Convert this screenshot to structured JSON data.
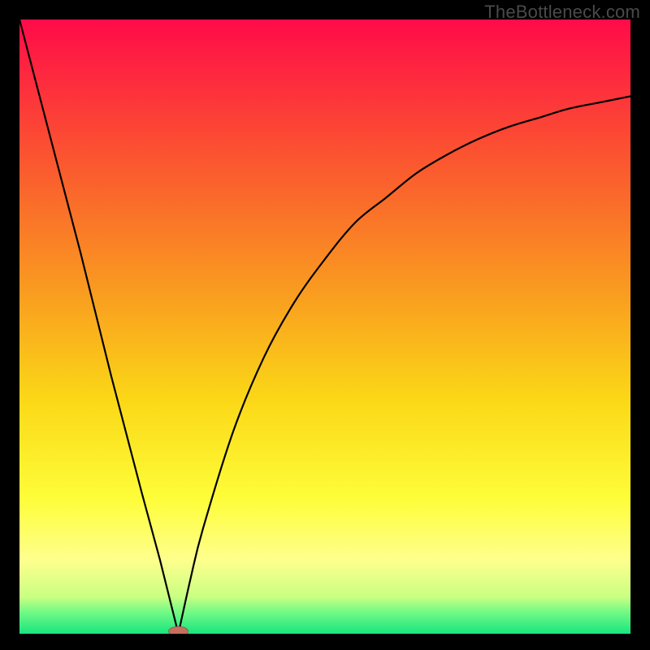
{
  "watermark": "TheBottleneck.com",
  "chart_data": {
    "type": "line",
    "title": "",
    "xlabel": "",
    "ylabel": "",
    "x_range": [
      0,
      100
    ],
    "y_range": [
      0,
      100
    ],
    "series": [
      {
        "name": "left-branch",
        "x": [
          0,
          5,
          10,
          15,
          20,
          23,
          25,
          26
        ],
        "values": [
          100,
          81,
          62,
          42,
          23,
          12,
          4,
          0
        ]
      },
      {
        "name": "right-branch",
        "x": [
          26,
          28,
          30,
          35,
          40,
          45,
          50,
          55,
          60,
          65,
          70,
          75,
          80,
          85,
          90,
          95,
          100
        ],
        "values": [
          0,
          9,
          17,
          33,
          45,
          54,
          61,
          67,
          71,
          75,
          78,
          80.5,
          82.5,
          84,
          85.5,
          86.5,
          87.5
        ]
      }
    ],
    "optimal_point": {
      "x": 26,
      "y": 0
    },
    "gradient_stops": [
      {
        "offset": 0.0,
        "color": "#ff0b49"
      },
      {
        "offset": 0.22,
        "color": "#fb5330"
      },
      {
        "offset": 0.45,
        "color": "#f99e1f"
      },
      {
        "offset": 0.62,
        "color": "#fbd817"
      },
      {
        "offset": 0.78,
        "color": "#fefd39"
      },
      {
        "offset": 0.88,
        "color": "#feff8d"
      },
      {
        "offset": 0.94,
        "color": "#c9ff82"
      },
      {
        "offset": 0.965,
        "color": "#72f986"
      },
      {
        "offset": 1.0,
        "color": "#18e57e"
      }
    ]
  }
}
